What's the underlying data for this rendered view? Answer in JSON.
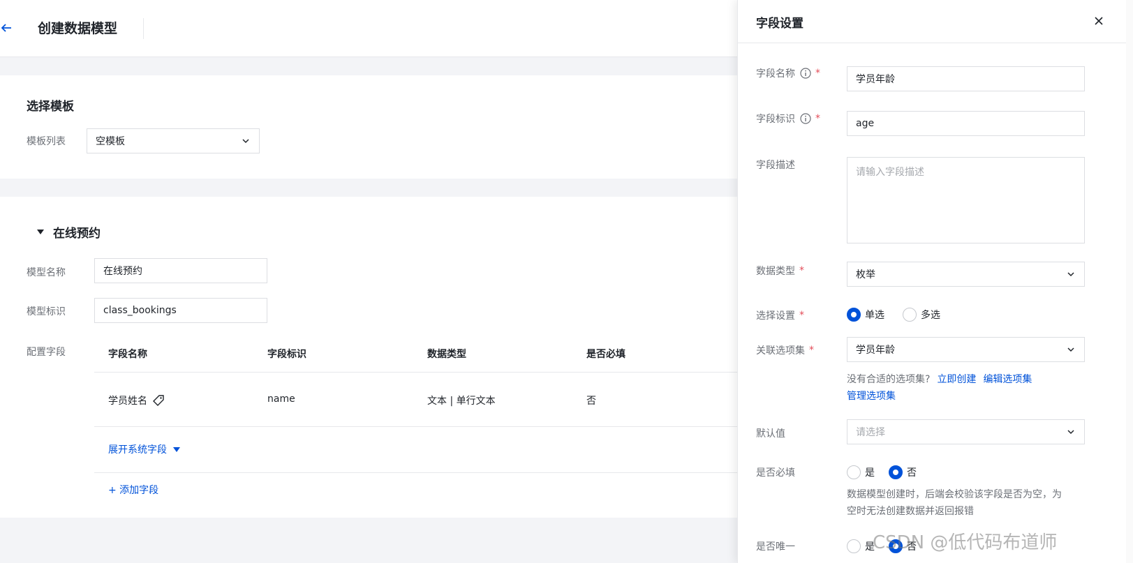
{
  "header": {
    "title": "创建数据模型"
  },
  "template_section": {
    "title": "选择模板",
    "list_label": "模板列表",
    "selected_template": "空模板"
  },
  "model_section": {
    "title": "在线预约",
    "name_label": "模型名称",
    "name_value": "在线预约",
    "id_label": "模型标识",
    "id_value": "class_bookings",
    "fields_label": "配置字段",
    "columns": [
      "字段名称",
      "字段标识",
      "数据类型",
      "是否必填"
    ],
    "rows": [
      {
        "name": "学员姓名",
        "id": "name",
        "type": "文本 | 单行文本",
        "required": "否"
      }
    ],
    "expand_system_fields": "展开系统字段",
    "add_field": "+ 添加字段"
  },
  "drawer": {
    "title": "字段设置",
    "field_name_label": "字段名称",
    "field_name_value": "学员年龄",
    "field_id_label": "字段标识",
    "field_id_value": "age",
    "field_desc_label": "字段描述",
    "field_desc_placeholder": "请输入字段描述",
    "data_type_label": "数据类型",
    "data_type_value": "枚举",
    "select_setting_label": "选择设置",
    "select_single": "单选",
    "select_multi": "多选",
    "option_set_label": "关联选项集",
    "option_set_value": "学员年龄",
    "option_hint": "没有合适的选项集?",
    "create_now": "立即创建",
    "edit_option_set": "编辑选项集",
    "manage_option_set": "管理选项集",
    "default_label": "默认值",
    "default_placeholder": "请选择",
    "required_label": "是否必填",
    "yes": "是",
    "no": "否",
    "required_hint_1": "数据模型创建时，后端会校验该字段是否为空，为",
    "required_hint_2": "空时无法创建数据并返回报错",
    "unique_label": "是否唯一"
  },
  "watermark": "CSDN @低代码布道师",
  "colors": {
    "primary": "#0052d9",
    "required": "#e34d59",
    "page_bg": "#f3f4f7"
  }
}
